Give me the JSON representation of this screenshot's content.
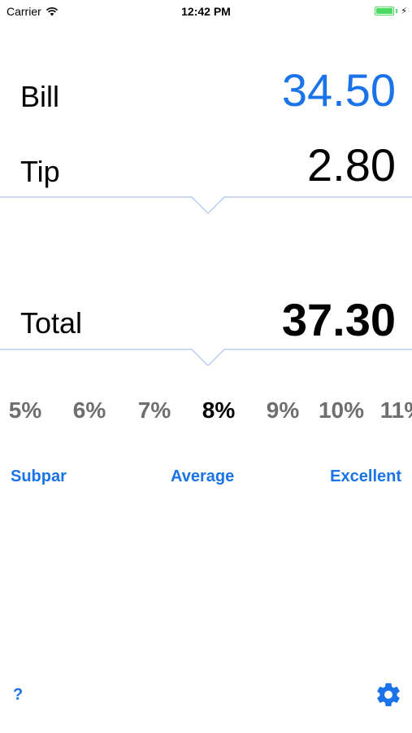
{
  "status_bar": {
    "carrier": "Carrier",
    "time": "12:42 PM",
    "icons": [
      "wifi-icon",
      "battery-icon",
      "charging-bolt-icon"
    ]
  },
  "bill": {
    "label": "Bill",
    "value": "34.50"
  },
  "tip": {
    "label": "Tip",
    "value": "2.80"
  },
  "total": {
    "label": "Total",
    "value": "37.30"
  },
  "percentages": {
    "options": [
      "5%",
      "6%",
      "7%",
      "8%",
      "9%",
      "10%",
      "11%"
    ],
    "selected": "8%"
  },
  "ratings": {
    "subpar": "Subpar",
    "average": "Average",
    "excellent": "Excellent"
  },
  "footer": {
    "help_label": "?",
    "settings_icon": "gear-icon"
  },
  "colors": {
    "accent": "#1a73e8",
    "divider": "#b8cdf0",
    "unselected_pct": "#6e6e6e",
    "battery": "#4cd964"
  }
}
